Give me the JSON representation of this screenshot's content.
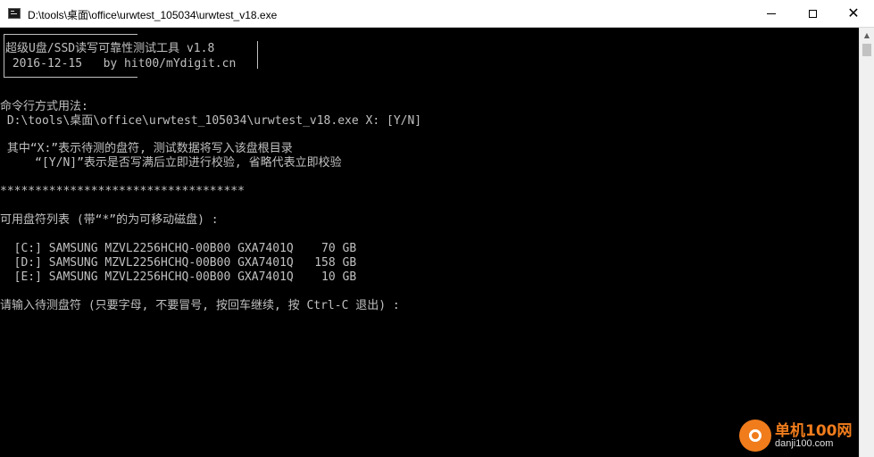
{
  "window": {
    "title": "D:\\tools\\桌面\\office\\urwtest_105034\\urwtest_v18.exe",
    "minimize_glyph": "",
    "maximize_glyph": "",
    "close_glyph": "✕"
  },
  "console": {
    "text_color": "#c0c0c0",
    "background": "#000000",
    "lines": [
      "超级U盘/SSD读写可靠性测试工具 v1.8",
      " 2016-12-15   by hit00/mYdigit.cn",
      "命令行方式用法:",
      " D:\\tools\\桌面\\office\\urwtest_105034\\urwtest_v18.exe X: [Y/N]",
      " 其中“X:”表示待测的盘符, 测试数据将写入该盘根目录",
      "     “[Y/N]”表示是否写满后立即进行校验, 省略代表立即校验",
      "***********************************",
      "可用盘符列表 (带“*”的为可移动磁盘) :",
      "  [C:] SAMSUNG MZVL2256HCHQ-00B00 GXA7401Q    70 GB",
      "  [D:] SAMSUNG MZVL2256HCHQ-00B00 GXA7401Q   158 GB",
      "  [E:] SAMSUNG MZVL2256HCHQ-00B00 GXA7401Q    10 GB",
      "请输入待测盘符 (只要字母, 不要冒号, 按回车继续, 按 Ctrl-C 退出) :"
    ]
  },
  "watermark": {
    "name": "单机100网",
    "url": "danji100.com",
    "color": "#f07c1c"
  }
}
